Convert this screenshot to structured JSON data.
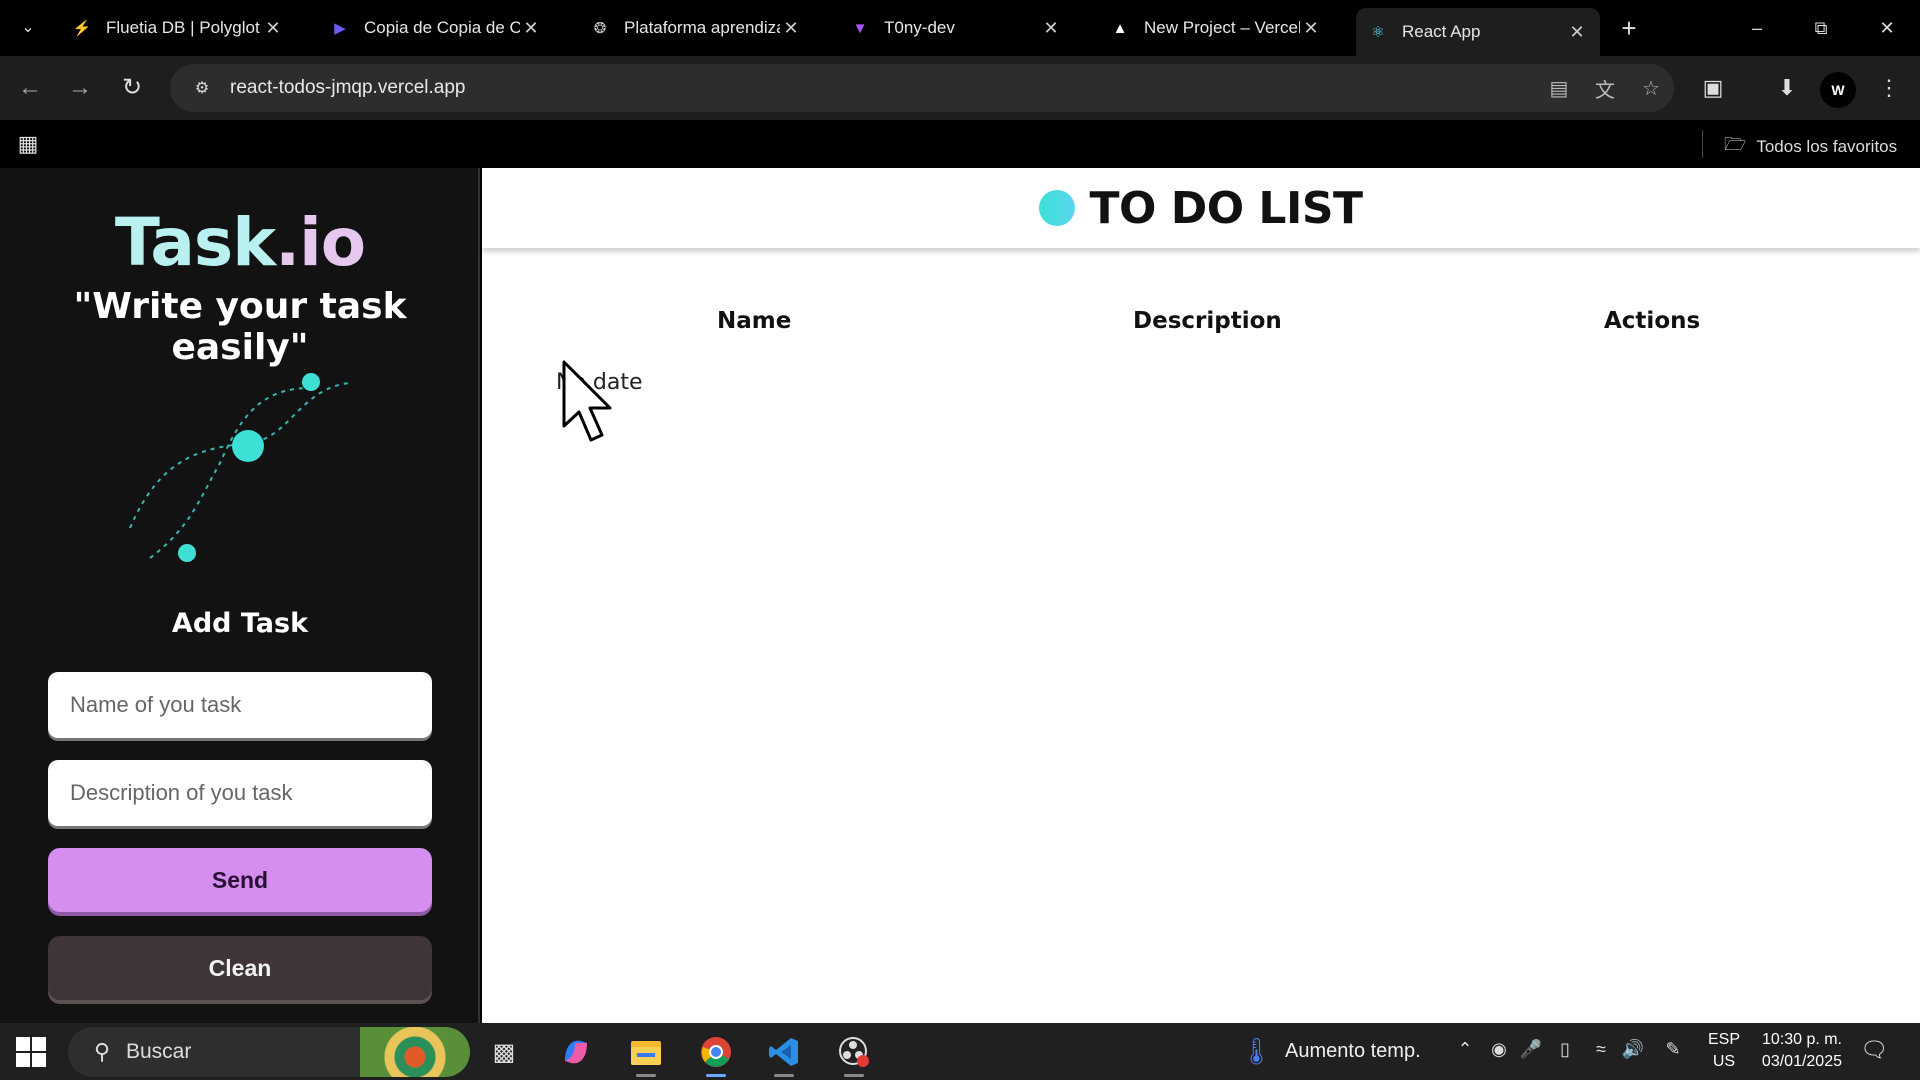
{
  "browser": {
    "tabs": [
      {
        "title": "Fluetia DB | Polyglot |",
        "icon": "bolt-icon",
        "color": "#3fb950"
      },
      {
        "title": "Copia de Copia de Ch",
        "icon": "slides-icon",
        "color": "#6a5cff"
      },
      {
        "title": "Plataforma aprendiza",
        "icon": "openai-icon",
        "color": "#cccccc"
      },
      {
        "title": "T0ny-dev",
        "icon": "vite-icon",
        "color": "#a855f7"
      },
      {
        "title": "New Project – Vercel",
        "icon": "vercel-icon",
        "color": "#ffffff"
      },
      {
        "title": "React App",
        "icon": "react-icon",
        "color": "#61dafb"
      }
    ],
    "active_tab": 5,
    "url": "react-todos-jmqp.vercel.app",
    "bookmarks_label": "Todos los favoritos",
    "profile_initial": "W"
  },
  "sidebar": {
    "brand_main": "Task",
    "brand_suffix": ".io",
    "tagline": "\"Write your task easily\"",
    "add_title": "Add Task",
    "name_placeholder": "Name of you task",
    "description_placeholder": "Description of you task",
    "send_label": "Send",
    "clean_label": "Clean"
  },
  "main": {
    "title": "TO DO LIST",
    "columns": [
      "Name",
      "Description",
      "Actions"
    ],
    "row_text": "No date"
  },
  "taskbar": {
    "search_placeholder": "Buscar",
    "weather": "Aumento temp.",
    "lang_line1": "ESP",
    "lang_line2": "US",
    "time": "10:30 p. m.",
    "date": "03/01/2025"
  },
  "colors": {
    "accent_purple": "#d58ef0",
    "accent_teal": "#3ee0d6",
    "sidebar_bg": "#121212"
  }
}
